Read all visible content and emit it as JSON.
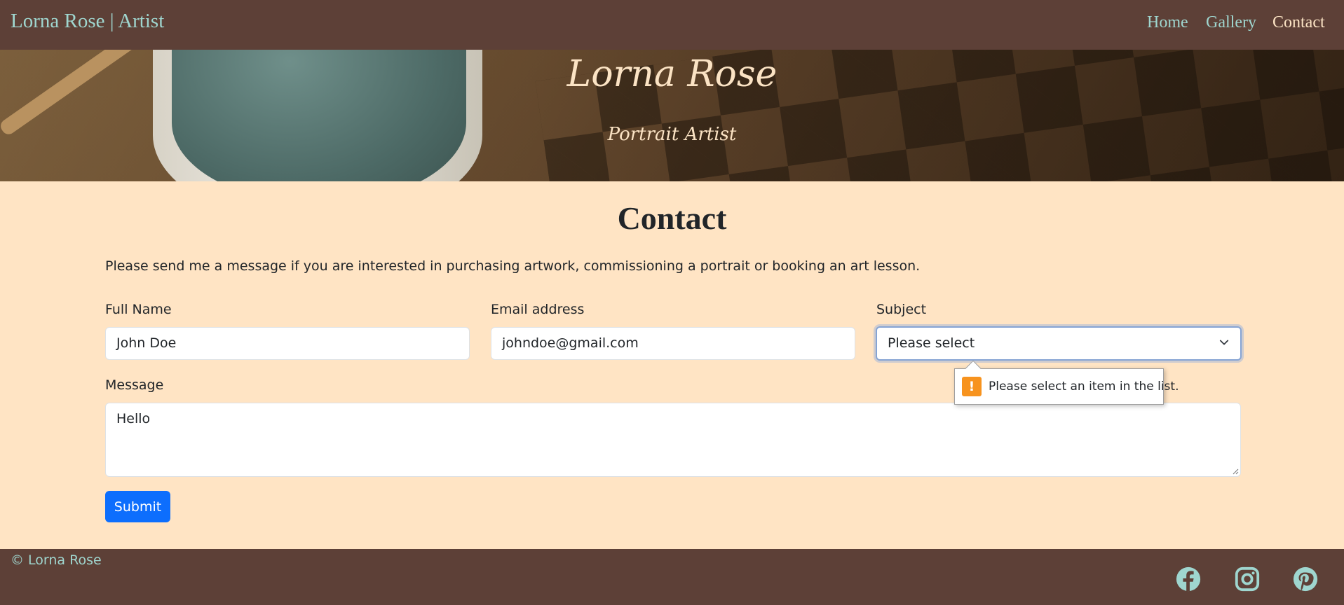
{
  "navbar": {
    "brand": "Lorna Rose | Artist",
    "links": [
      {
        "label": "Home",
        "active": false
      },
      {
        "label": "Gallery",
        "active": false
      },
      {
        "label": "Contact",
        "active": true
      }
    ]
  },
  "hero": {
    "title": "Lorna Rose",
    "subtitle": "Portrait Artist"
  },
  "main": {
    "title": "Contact",
    "intro": "Please send me a message if you are interested in purchasing artwork, commissioning a portrait or booking an art lesson."
  },
  "form": {
    "full_name": {
      "label": "Full Name",
      "value": "John Doe"
    },
    "email": {
      "label": "Email address",
      "value": "johndoe@gmail.com"
    },
    "subject": {
      "label": "Subject",
      "selected": "Please select"
    },
    "message": {
      "label": "Message",
      "value": "Hello"
    },
    "submit_label": "Submit"
  },
  "validation": {
    "message": "Please select an item in the list.",
    "icon": "warning-icon",
    "icon_glyph": "!"
  },
  "footer": {
    "copyright": "© Lorna Rose",
    "social": [
      "facebook-icon",
      "instagram-icon",
      "pinterest-icon"
    ]
  },
  "colors": {
    "navbar_bg": "#5d4037",
    "nav_link": "#9fd6cf",
    "nav_active": "#fbe3c4",
    "page_bg": "#ffe4c4",
    "primary_button": "#0d6efd",
    "warning": "#f7931e"
  }
}
